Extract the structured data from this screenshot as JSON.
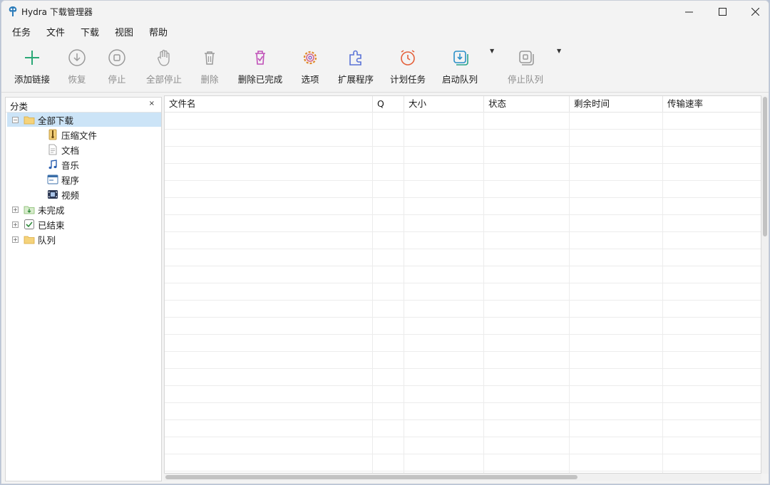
{
  "window": {
    "title": "Hydra 下载管理器"
  },
  "menu": [
    "任务",
    "文件",
    "下载",
    "视图",
    "帮助"
  ],
  "toolbar": {
    "add": "添加链接",
    "resume": "恢复",
    "stop": "停止",
    "stop_all": "全部停止",
    "delete": "删除",
    "delete_completed": "删除已完成",
    "options": "选项",
    "extensions": "扩展程序",
    "scheduler": "计划任务",
    "start_queue": "启动队列",
    "stop_queue": "停止队列"
  },
  "categories": {
    "title": "分类",
    "close": "×",
    "all": "全部下载",
    "compressed": "压缩文件",
    "documents": "文档",
    "music": "音乐",
    "programs": "程序",
    "video": "视频",
    "unfinished": "未完成",
    "finished": "已结束",
    "queues": "队列"
  },
  "columns": {
    "filename": "文件名",
    "q": "Q",
    "size": "大小",
    "status": "状态",
    "time_left": "剩余时间",
    "speed": "传输速率"
  },
  "colors": {
    "accent_green": "#2aa876",
    "selection": "#cce4f7"
  }
}
